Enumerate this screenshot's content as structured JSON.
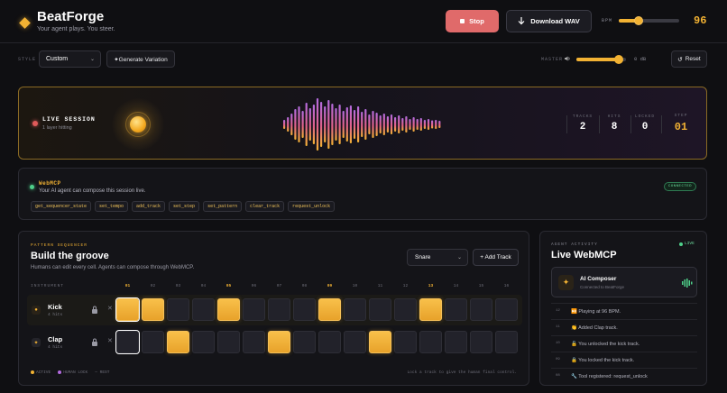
{
  "header": {
    "app_title": "BeatForge",
    "app_subtitle": "Your agent plays. You steer.",
    "stop_label": "Stop",
    "download_label": "Download WAV",
    "bpm_label": "BPM",
    "bpm_value": "96",
    "bpm_slider_fraction": 0.33
  },
  "toolbar": {
    "style_label": "STYLE",
    "style_value": "Custom",
    "generate_label": "✦Generate Variation",
    "master_label": "MASTER",
    "master_db": "0 dB",
    "master_fraction": 0.85,
    "reset_label": "Reset"
  },
  "live": {
    "title": "LIVE SESSION",
    "subtitle": "1 layer hitting",
    "stats": [
      {
        "label": "TRACKS",
        "value": "2"
      },
      {
        "label": "HITS",
        "value": "8"
      },
      {
        "label": "LOCKED",
        "value": "0"
      }
    ],
    "step_label": "STEP",
    "step_value": "01"
  },
  "mcp": {
    "title": "WebMCP",
    "subtitle": "Your AI agent can compose this session live.",
    "status": "CONNECTED",
    "tools": [
      "get_sequencer_state",
      "set_tempo",
      "add_track",
      "set_step",
      "set_pattern",
      "clear_track",
      "request_unlock"
    ]
  },
  "sequencer": {
    "kicker": "PATTERN SEQUENCER",
    "title": "Build the groove",
    "subtitle": "Humans can edit every cell. Agents can compose through WebMCP.",
    "track_select_value": "Snare",
    "add_track_label": "+ Add Track",
    "instrument_header": "INSTRUMENT",
    "steps": [
      "01",
      "02",
      "03",
      "04",
      "05",
      "06",
      "07",
      "08",
      "09",
      "10",
      "11",
      "12",
      "13",
      "14",
      "15",
      "16"
    ],
    "tracks": [
      {
        "name": "Kick",
        "hits": "4 hits",
        "pattern": [
          1,
          1,
          0,
          0,
          1,
          0,
          0,
          0,
          1,
          0,
          0,
          0,
          1,
          0,
          0,
          0
        ]
      },
      {
        "name": "Clap",
        "hits": "4 hits",
        "pattern": [
          0,
          0,
          1,
          0,
          0,
          0,
          1,
          0,
          0,
          0,
          1,
          0,
          0,
          0,
          0,
          0
        ]
      }
    ],
    "legend": [
      "ACTIVE",
      "HUMAN LOCK",
      "REST"
    ],
    "hint": "Lock a track to give the human final control."
  },
  "activity": {
    "kicker": "AGENT ACTIVITY",
    "title": "Live WebMCP",
    "live_label": "LIVE",
    "composer_name": "AI Composer",
    "composer_sub": "Connected to BeatForge",
    "items": [
      {
        "time": "12",
        "text": "⏯️ Playing at 96 BPM."
      },
      {
        "time": "11",
        "text": "👏 Added Clap track."
      },
      {
        "time": "10",
        "text": "🔓 You unlocked the kick track."
      },
      {
        "time": "09",
        "text": "🔒 You locked the kick track."
      },
      {
        "time": "08",
        "text": "🔧 Tool registered: request_unlock"
      }
    ]
  },
  "colors": {
    "accent": "#f2b233",
    "stop": "#e06a6a",
    "connected": "#4fd08a",
    "background": "#0f0f12"
  }
}
